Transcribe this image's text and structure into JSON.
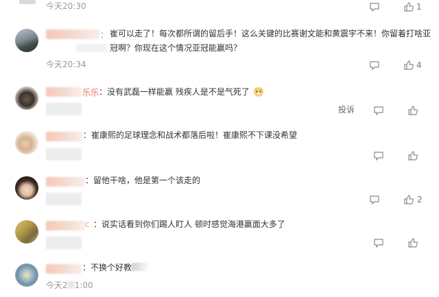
{
  "comments": [
    {
      "text": "",
      "time": "今天20:30",
      "like_count": "1"
    },
    {
      "name_tail": "：",
      "text": "崔可以走了！每次都所谓的留后手！这么关键的比赛谢文能和黄震宇不来！你留着打啥亚冠啊？你现在这个情况亚冠能赢吗？",
      "time": "今天20:34",
      "like_count": "4"
    },
    {
      "name_tail": "乐乐",
      "text": "：没有武磊一样能赢 残疾人是不是气死了",
      "report_label": "投诉",
      "like_count": ""
    },
    {
      "name_tail": "",
      "text": "：崔康熙的足球理念和战术都落后啦！崔康熙不下课没希望",
      "like_count": ""
    },
    {
      "name_tail": "",
      "text": "：留他干啥，他是第一个该走的",
      "like_count": "2"
    },
    {
      "name_tail": "c",
      "text": "：说实话看到你们踢人盯人 顿时感觉海港赢面大多了",
      "like_count": ""
    },
    {
      "name_tail": "",
      "text": "：不换个好教",
      "time": "今天2",
      "time_tail": "1:00",
      "like_count": ""
    }
  ],
  "icons": {
    "comment": "comment-bubble-icon",
    "like": "thumbs-up-icon",
    "emoji": "doge-emoji-icon"
  },
  "colors": {
    "name": "#eb7350",
    "meta": "#999999",
    "text": "#333333"
  }
}
